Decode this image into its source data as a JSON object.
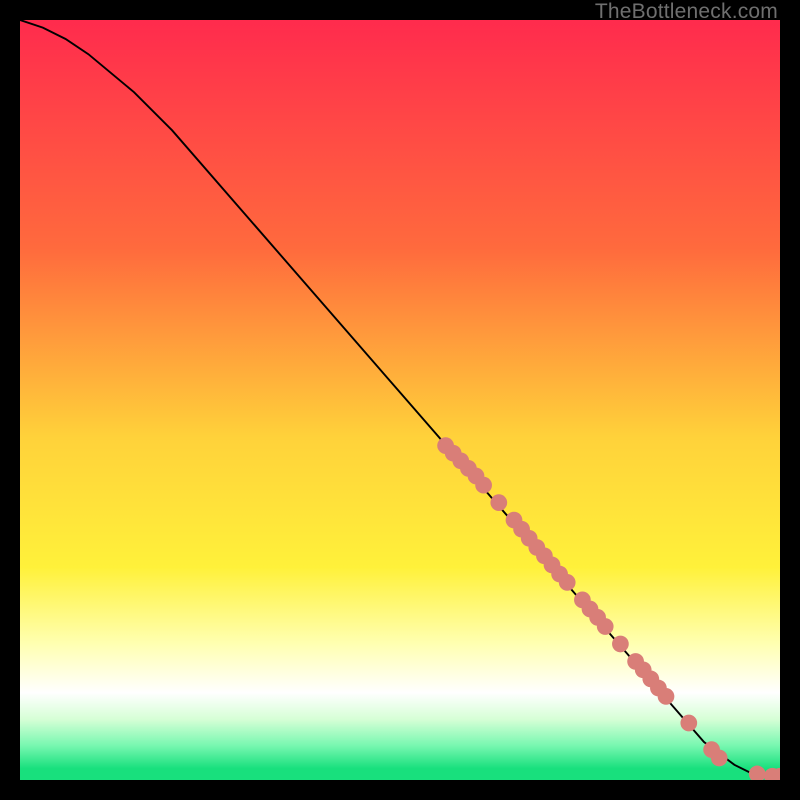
{
  "watermark": "TheBottleneck.com",
  "chart_data": {
    "type": "line",
    "title": "",
    "xlabel": "",
    "ylabel": "",
    "xlim": [
      0,
      100
    ],
    "ylim": [
      0,
      100
    ],
    "background_gradient": [
      {
        "stop": 0.0,
        "color": "#ff2b4d"
      },
      {
        "stop": 0.3,
        "color": "#ff6a3d"
      },
      {
        "stop": 0.55,
        "color": "#ffd23a"
      },
      {
        "stop": 0.72,
        "color": "#fff13a"
      },
      {
        "stop": 0.82,
        "color": "#ffffb0"
      },
      {
        "stop": 0.885,
        "color": "#ffffff"
      },
      {
        "stop": 0.92,
        "color": "#d6ffd6"
      },
      {
        "stop": 0.955,
        "color": "#77f7b0"
      },
      {
        "stop": 0.985,
        "color": "#18e07d"
      },
      {
        "stop": 1.0,
        "color": "#18e07d"
      }
    ],
    "series": [
      {
        "name": "bottleneck-curve",
        "color": "#000000",
        "x": [
          0,
          3,
          6,
          9,
          12,
          15,
          20,
          30,
          40,
          50,
          60,
          70,
          80,
          90,
          94,
          96,
          98,
          100
        ],
        "y": [
          100,
          99,
          97.5,
          95.5,
          93,
          90.5,
          85.5,
          74,
          62.5,
          51,
          39.5,
          28,
          16.5,
          5,
          2,
          1,
          0.5,
          0.5
        ]
      }
    ],
    "markers": {
      "name": "highlight-points",
      "color": "#d97e78",
      "radius": 1.1,
      "points_xy": [
        [
          56,
          44
        ],
        [
          57,
          43
        ],
        [
          58,
          42
        ],
        [
          59,
          41
        ],
        [
          60,
          40
        ],
        [
          61,
          38.8
        ],
        [
          63,
          36.5
        ],
        [
          65,
          34.2
        ],
        [
          66,
          33
        ],
        [
          67,
          31.8
        ],
        [
          68,
          30.6
        ],
        [
          69,
          29.5
        ],
        [
          70,
          28.3
        ],
        [
          71,
          27.1
        ],
        [
          72,
          26
        ],
        [
          74,
          23.7
        ],
        [
          75,
          22.5
        ],
        [
          76,
          21.4
        ],
        [
          77,
          20.2
        ],
        [
          79,
          17.9
        ],
        [
          81,
          15.6
        ],
        [
          82,
          14.5
        ],
        [
          83,
          13.3
        ],
        [
          84,
          12.1
        ],
        [
          85,
          11
        ],
        [
          88,
          7.5
        ],
        [
          91,
          4
        ],
        [
          92,
          2.9
        ],
        [
          97,
          0.8
        ],
        [
          99,
          0.5
        ],
        [
          100,
          0.5
        ]
      ]
    }
  }
}
